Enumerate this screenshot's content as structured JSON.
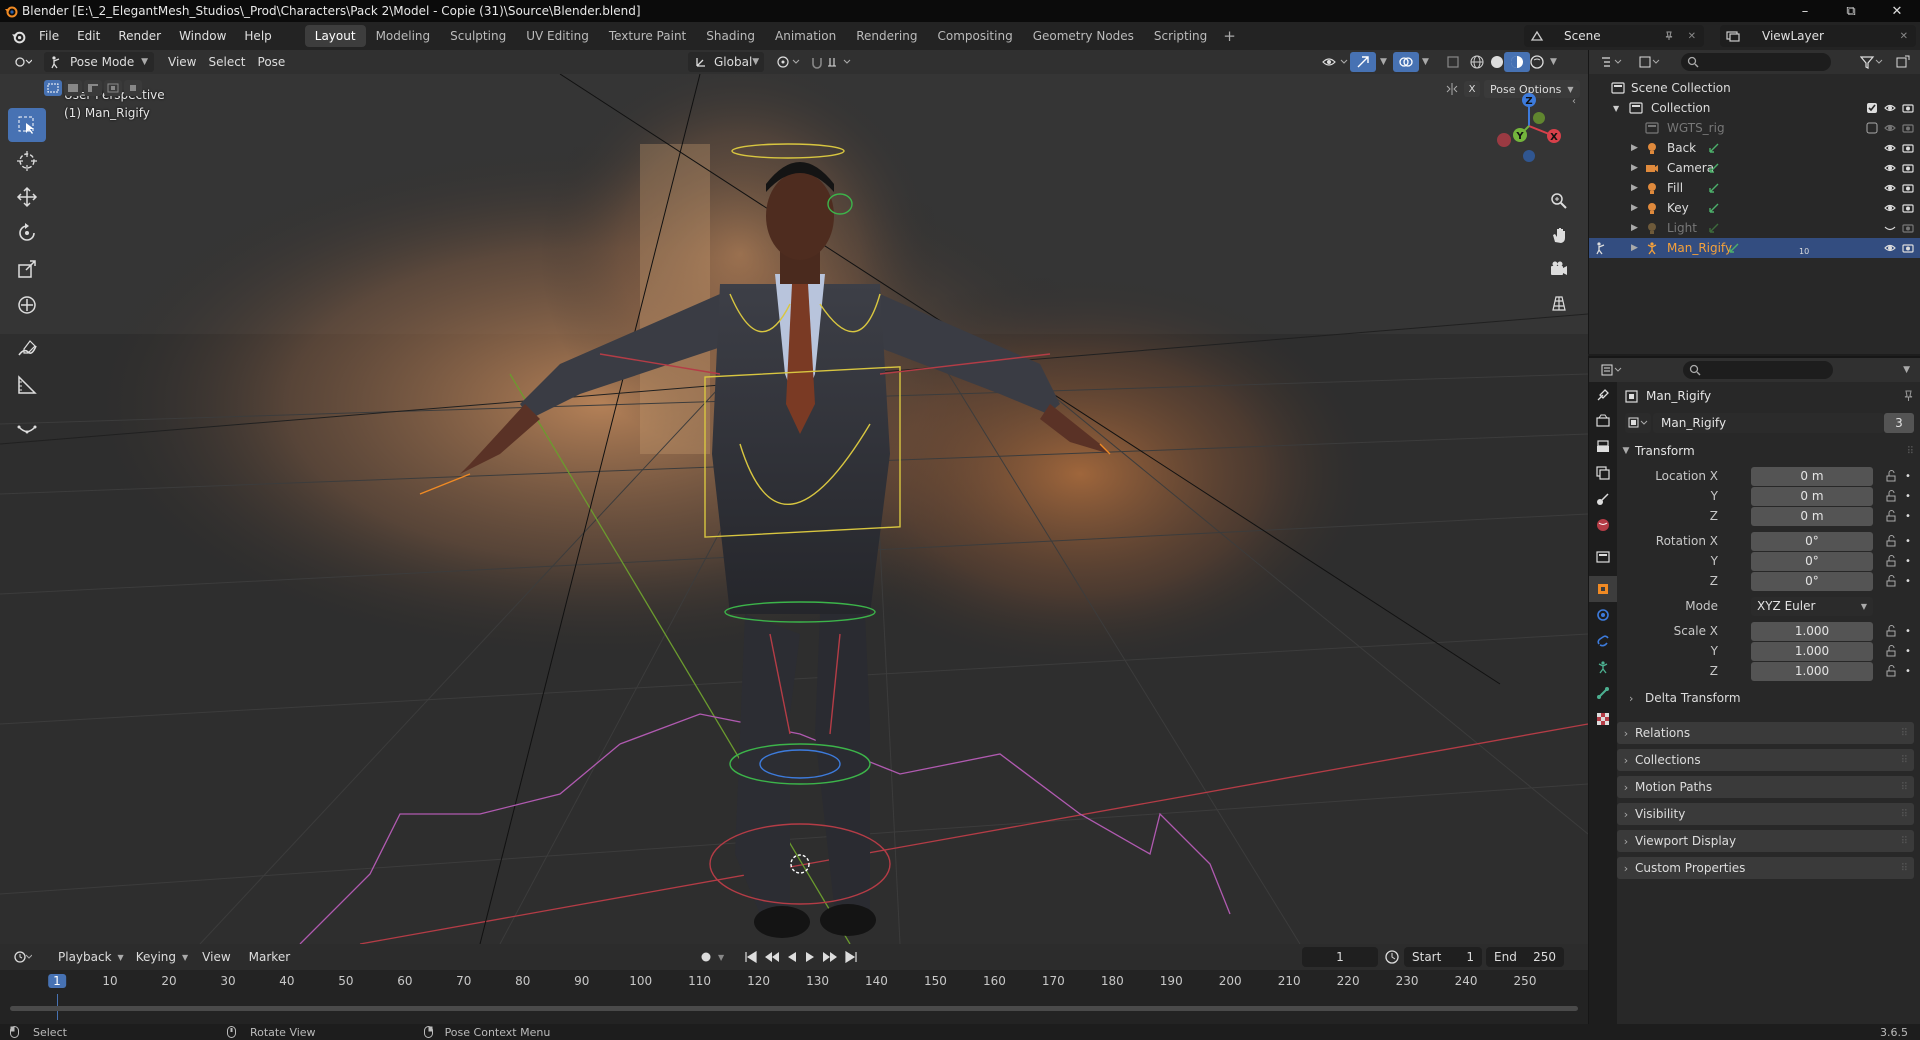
{
  "window": {
    "title": "Blender [E:\\_2_ElegantMesh_Studios\\_Prod\\Characters\\Pack 2\\Model - Copie (31)\\Source\\Blender.blend]",
    "controls": [
      "–",
      "⧉",
      "✕"
    ]
  },
  "menus": [
    "File",
    "Edit",
    "Render",
    "Window",
    "Help"
  ],
  "workspaces": [
    "Layout",
    "Modeling",
    "Sculpting",
    "UV Editing",
    "Texture Paint",
    "Shading",
    "Animation",
    "Rendering",
    "Compositing",
    "Geometry Nodes",
    "Scripting"
  ],
  "active_workspace": "Layout",
  "scene": {
    "name": "Scene",
    "view_layer": "ViewLayer"
  },
  "viewport_header": {
    "mode": "Pose Mode",
    "menus": [
      "View",
      "Select",
      "Pose"
    ],
    "transform_orientation": "Global",
    "pose_options": "Pose Options",
    "x_label": "X"
  },
  "viewport": {
    "perspective_label": "User Perspective",
    "object_label": "(1) Man_Rigify",
    "gizmo_axes": [
      "X",
      "Y",
      "Z"
    ]
  },
  "tools": [
    "select-box-icon",
    "cursor-icon",
    "move-icon",
    "rotate-icon",
    "scale-icon",
    "transform-icon",
    "annotate-icon",
    "measure-icon",
    "relax-pose-icon"
  ],
  "outliner": {
    "scene_collection": "Scene Collection",
    "collection": "Collection",
    "items": [
      {
        "name": "WGTS_rig",
        "dim": true
      },
      {
        "name": "Back",
        "dim": false
      },
      {
        "name": "Camera",
        "dim": false
      },
      {
        "name": "Fill",
        "dim": false
      },
      {
        "name": "Key",
        "dim": false
      },
      {
        "name": "Light",
        "dim": true
      },
      {
        "name": "Man_Rigify",
        "dim": false,
        "selected": true,
        "modifier_count": "10"
      }
    ]
  },
  "properties": {
    "object_name": "Man_Rigify",
    "datablock_name": "Man_Rigify",
    "users": "3",
    "transform_label": "Transform",
    "location": {
      "label": "Location X",
      "x": "0 m",
      "y": "0 m",
      "z": "0 m"
    },
    "rotation": {
      "label": "Rotation X",
      "x": "0°",
      "y": "0°",
      "z": "0°"
    },
    "mode_label": "Mode",
    "mode_value": "XYZ Euler",
    "scale": {
      "label": "Scale X",
      "x": "1.000",
      "y": "1.000",
      "z": "1.000"
    },
    "axis_y": "Y",
    "axis_z": "Z",
    "panels": [
      "Delta Transform",
      "Relations",
      "Collections",
      "Motion Paths",
      "Visibility",
      "Viewport Display",
      "Custom Properties"
    ]
  },
  "timeline": {
    "menus": [
      "Playback",
      "Keying",
      "View",
      "Marker"
    ],
    "current_frame": "1",
    "start_label": "Start",
    "start": "1",
    "end_label": "End",
    "end": "250",
    "ruler": [
      "1",
      "10",
      "20",
      "30",
      "40",
      "50",
      "60",
      "70",
      "80",
      "90",
      "100",
      "110",
      "120",
      "130",
      "140",
      "150",
      "160",
      "170",
      "180",
      "190",
      "200",
      "210",
      "220",
      "230",
      "240",
      "250"
    ]
  },
  "statusbar": {
    "select": "Select",
    "rotate_view": "Rotate View",
    "context_menu": "Pose Context Menu",
    "version": "3.6.5"
  },
  "colors": {
    "accent": "#4772b3",
    "x_axis": "#d8404a",
    "y_axis": "#74b53c",
    "z_axis": "#3d7bdc",
    "selected_text": "#f5a13a"
  }
}
